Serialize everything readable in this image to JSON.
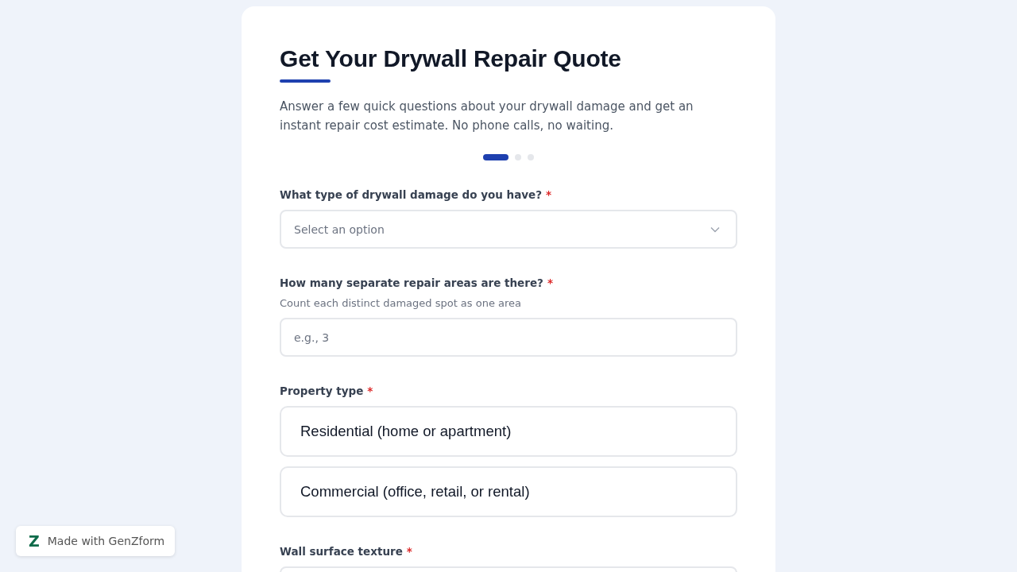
{
  "form": {
    "title": "Get Your Drywall Repair Quote",
    "description": "Answer a few quick questions about your drywall damage and get an instant repair cost estimate. No phone calls, no waiting.",
    "steps": [
      {
        "selected": true
      },
      {
        "selected": false
      },
      {
        "selected": false
      }
    ],
    "fields": [
      {
        "kind": "select",
        "label": "What type of drywall damage do you have?",
        "required_mark": "*",
        "placeholder": "Select an option"
      },
      {
        "kind": "number",
        "label": "How many separate repair areas are there?",
        "required_mark": "*",
        "hint": "Count each distinct damaged spot as one area",
        "placeholder": "e.g., 3"
      },
      {
        "kind": "choice",
        "label": "Property type",
        "required_mark": "*",
        "options": [
          {
            "label": "Residential (home or apartment)",
            "selected": false
          },
          {
            "label": "Commercial (office, retail, or rental)",
            "selected": false
          }
        ]
      },
      {
        "kind": "partial",
        "label": "Wall surface texture",
        "required_mark": "*"
      }
    ]
  },
  "badge": {
    "logo": "Z",
    "text": "Made with GenZform"
  }
}
